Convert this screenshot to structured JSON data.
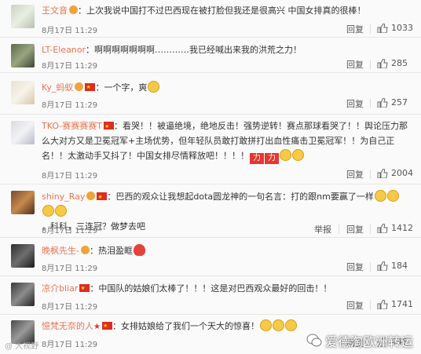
{
  "comments": [
    {
      "user": "王文音",
      "text": "上次我说中国打不过巴西现在被打脸但我还是很高兴 中国女排真的很棒！",
      "date": "8月17日 11:29",
      "reply": "回复",
      "likes": "1033"
    },
    {
      "user": "LT-Eleanor",
      "text": "啊啊啊啊啊啊啊…………我已经喊出来我的洪荒之力！",
      "date": "8月17日 11:29",
      "reply": "回复",
      "likes": "285"
    },
    {
      "user": "Ky_蚂蚁",
      "text": "一个字，爽",
      "date": "8月17日 11:29",
      "reply": "回复",
      "likes": "257"
    },
    {
      "user": "TKO-赛赛赛赛T",
      "text": "看哭！！被逼绝境，绝地反击！强势逆转！赛点那球看哭了！！舆论压力那么大对方又是卫冕冠军+主场优势，但年轻队员敢打敢拼打出血性痛击卫冕冠军！！为自己正名！！太激动手又抖了！中国女排尽情释放吧！！！！",
      "tags": [
        "力",
        "力"
      ],
      "date": "8月17日 11:29",
      "reply": "回复",
      "likes": "2004"
    },
    {
      "user": "shiny_Ray",
      "text": "巴西的观众让我想起dota圆龙神的一句名言：打的跟nm要赢了一样",
      "text2": "，科科，三连冠？做梦去吧",
      "date": "8月17日 11:29",
      "report": "举报",
      "reply": "回复",
      "likes": "1412"
    },
    {
      "user": "晚枫先生-",
      "text": "热泪盈眶",
      "date": "8月17日 11:29",
      "reply": "回复",
      "likes": "184"
    },
    {
      "user": "凉介bliar",
      "text": "中国队的姑娘们太棒了！！！这是对巴西观众最好的回击！！",
      "date": "8月17日 11:29",
      "reply": "回复",
      "likes": "1741"
    },
    {
      "user": "憶梵无奈的人",
      "text": "女排姑娘给了我们一个天大的惊喜！",
      "date": "8月17日 11:29",
      "reply": "回复",
      "likes": "448"
    }
  ],
  "watermark": {
    "text": "爱德淘欧洲转运",
    "left_text": "@ 大视野"
  },
  "colors": {
    "username": "#eb7350",
    "emoji": "#f7c948",
    "tag": "#e7352f"
  }
}
